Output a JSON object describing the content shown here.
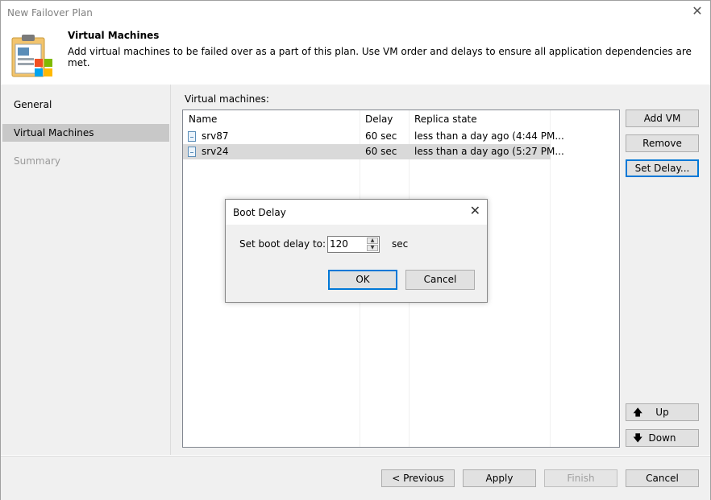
{
  "window": {
    "title": "New Failover Plan"
  },
  "header": {
    "title": "Virtual Machines",
    "description": "Add virtual machines to be failed over as a part of this plan. Use VM order and delays to ensure all application dependencies are met."
  },
  "nav": {
    "items": [
      {
        "label": "General",
        "state": "normal"
      },
      {
        "label": "Virtual Machines",
        "state": "active"
      },
      {
        "label": "Summary",
        "state": "disabled"
      }
    ]
  },
  "vm_section": {
    "label": "Virtual machines:",
    "columns": [
      "Name",
      "Delay",
      "Replica state"
    ],
    "rows": [
      {
        "name": "srv87",
        "delay": "60 sec",
        "replica_state": "less than a day ago (4:44 PM..."
      },
      {
        "name": "srv24",
        "delay": "60 sec",
        "replica_state": "less than a day ago (5:27 PM..."
      }
    ],
    "selected_row": 1
  },
  "side_buttons": {
    "add_vm": "Add VM",
    "remove": "Remove",
    "set_delay": "Set Delay...",
    "up": "Up",
    "down": "Down"
  },
  "footer": {
    "previous": "< Previous",
    "apply": "Apply",
    "finish": "Finish",
    "cancel": "Cancel"
  },
  "dialog": {
    "title": "Boot Delay",
    "label": "Set boot delay to:",
    "value": "120",
    "unit": "sec",
    "ok": "OK",
    "cancel": "Cancel"
  },
  "colors": {
    "accent": "#0078d7",
    "panel": "#f0f0f0",
    "selection": "#d9d9d9"
  }
}
